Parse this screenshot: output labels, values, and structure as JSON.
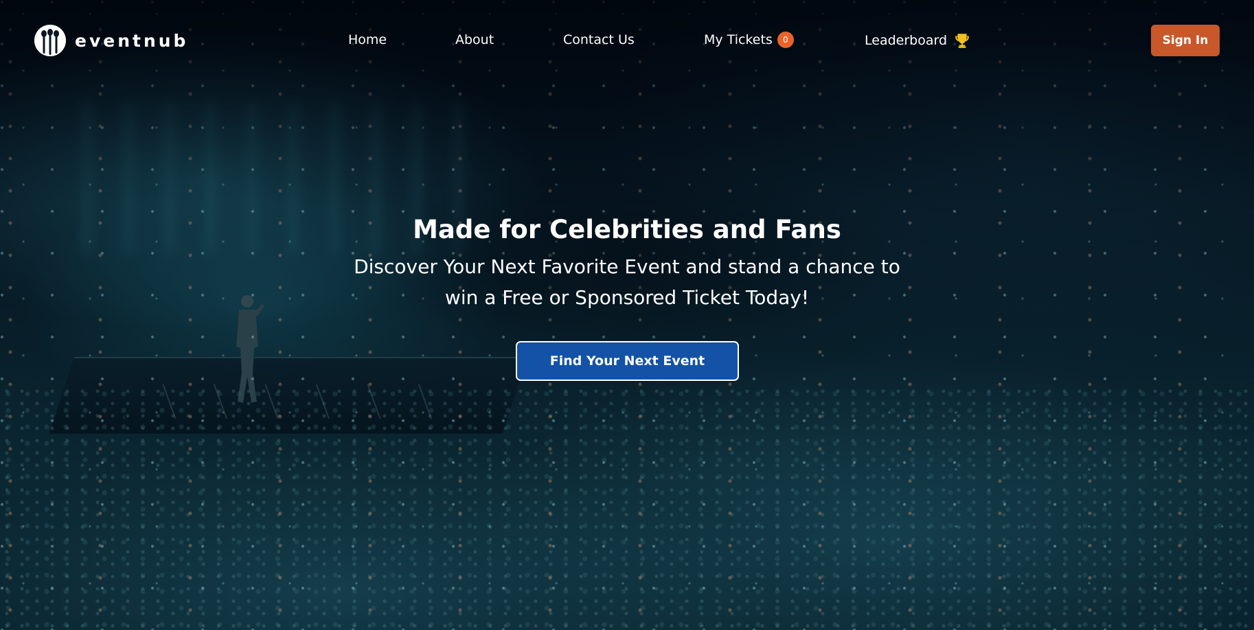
{
  "brand": {
    "name": "eventnub",
    "logo_icon": "microphones-logo-icon"
  },
  "nav": {
    "links": [
      {
        "label": "Home"
      },
      {
        "label": "About"
      },
      {
        "label": "Contact Us"
      },
      {
        "label": "My Tickets",
        "badge": "0"
      },
      {
        "label": "Leaderboard",
        "icon": "trophy-icon"
      }
    ],
    "signin_label": "Sign In"
  },
  "hero": {
    "title": "Made for Celebrities and Fans",
    "subtitle": "Discover Your Next Favorite Event and stand a chance to win a Free or Sponsored Ticket Today!",
    "cta_label": "Find Your Next Event",
    "background": "concert-crowd-image"
  },
  "colors": {
    "signin_bg": "#c8582a",
    "badge_bg": "#e9642a",
    "cta_bg": "#1352a6",
    "trophy": "#f2c21a",
    "text": "#ffffff"
  }
}
